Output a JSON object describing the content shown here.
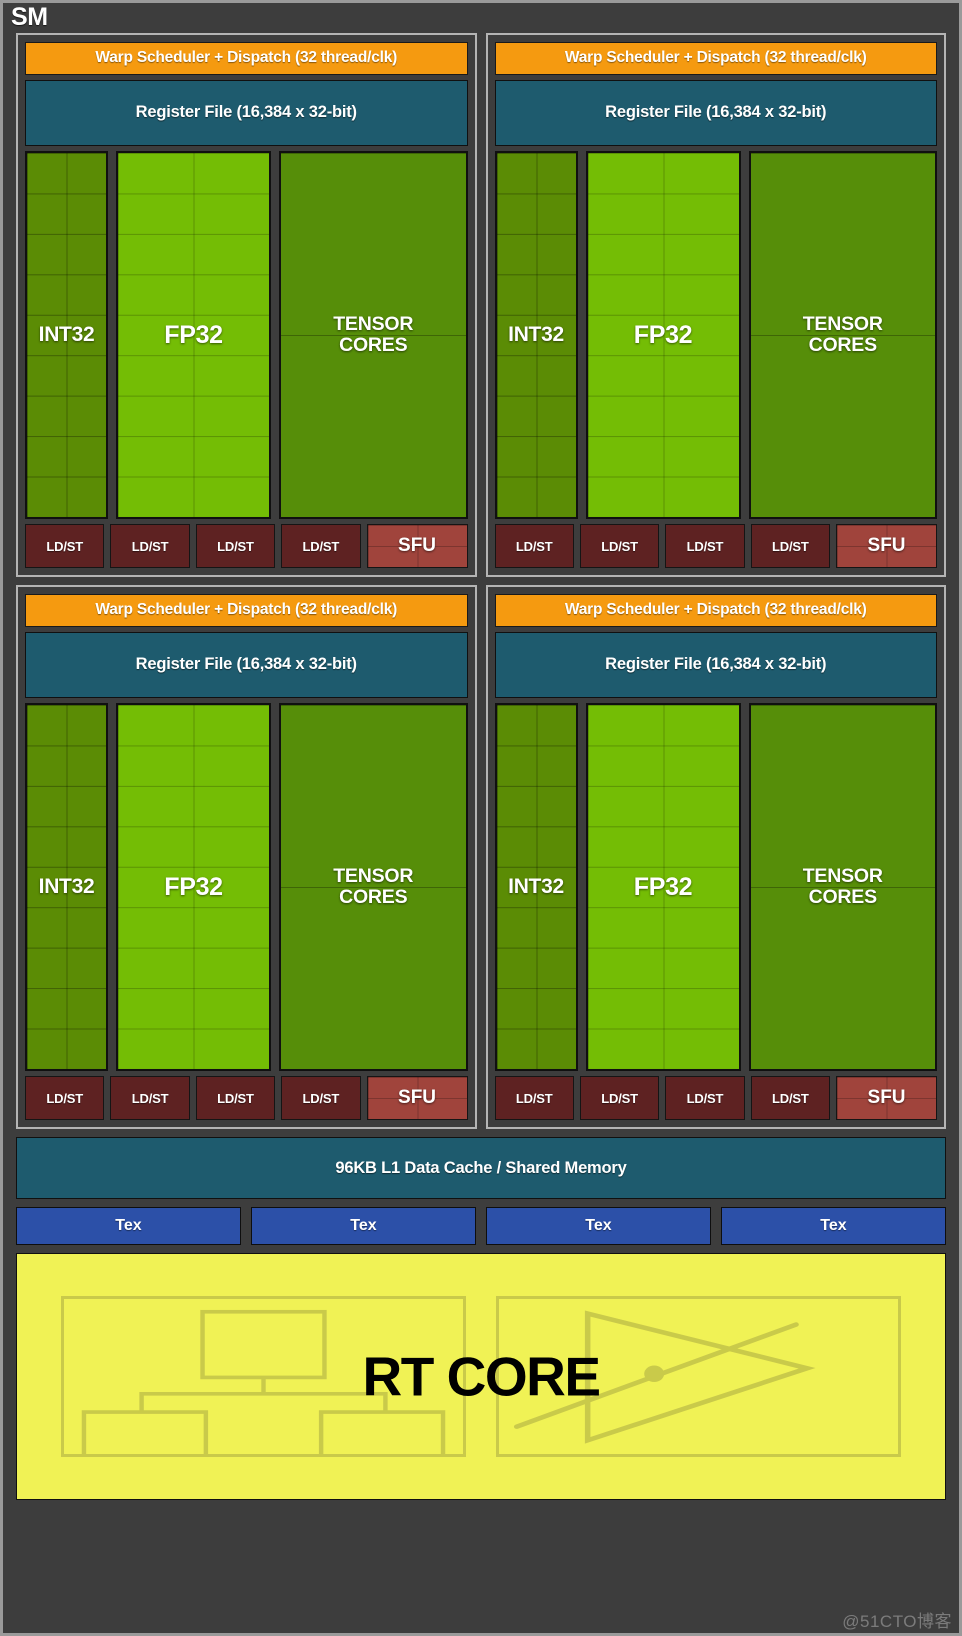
{
  "diagram": {
    "title": "SM",
    "watermark": "@51CTO博客"
  },
  "partition": {
    "warp_scheduler": "Warp Scheduler + Dispatch (32 thread/clk)",
    "register_file": "Register File (16,384 x 32-bit)",
    "lanes": [
      {
        "label": "INT32",
        "type": "int32",
        "color": "#5b8c05",
        "rows": 9,
        "cols": 2
      },
      {
        "label": "FP32",
        "type": "fp32",
        "color": "#74bd05",
        "rows": 9,
        "cols": 2
      },
      {
        "label": "TENSOR CORES",
        "label_line1": "TENSOR",
        "label_line2": "CORES",
        "type": "tensor",
        "color": "#568e09",
        "rows": 2,
        "cols": 1
      }
    ],
    "ldst_label": "LD/ST",
    "ldst_count": 4,
    "sfu_label": "SFU",
    "ldst_color": "#5e2222",
    "sfu_color": "#a0443c"
  },
  "partitions": [
    {
      "id": "partition-top-left"
    },
    {
      "id": "partition-top-right"
    },
    {
      "id": "partition-bottom-left"
    },
    {
      "id": "partition-bottom-right"
    }
  ],
  "shared": {
    "l1_cache": "96KB L1 Data Cache / Shared Memory",
    "l1_color": "#1e5b6e",
    "tex_label": "Tex",
    "tex_count": 4,
    "tex_color": "#2c50a8"
  },
  "rt_core": {
    "label": "RT CORE",
    "background": "#f0f255",
    "line_color": "#c9ca4a",
    "left_panel_icon": "bvh-tree-icon",
    "right_panel_icon": "ray-triangle-intersection-icon"
  },
  "colors": {
    "background": "#3d3d3d",
    "frame_border": "#9a9a9a",
    "warp_scheduler": "#f59a10",
    "register_file": "#1e5b6e"
  }
}
